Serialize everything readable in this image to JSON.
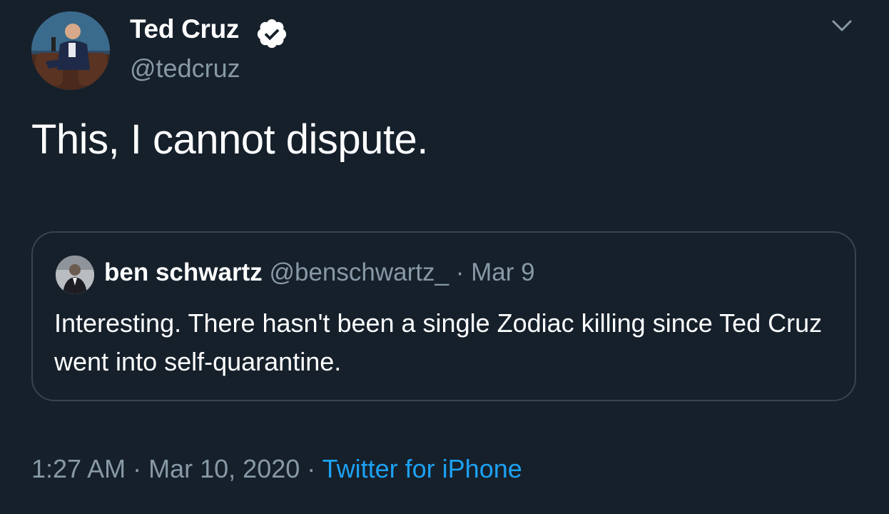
{
  "author": {
    "name": "Ted Cruz",
    "handle": "@tedcruz",
    "verified_icon": "verified-badge-icon"
  },
  "tweet": {
    "text": "This, I cannot dispute."
  },
  "quoted_tweet": {
    "name": "ben schwartz",
    "handle": "@benschwartz_",
    "separator": "·",
    "date": "Mar 9",
    "text": "Interesting. There hasn't been a single Zodiac killing since Ted Cruz went into self-quarantine."
  },
  "meta": {
    "time": "1:27 AM",
    "separator1": "·",
    "date": "Mar 10, 2020",
    "separator2": "·",
    "source": "Twitter for iPhone"
  },
  "colors": {
    "background": "#15202b",
    "text_primary": "#ffffff",
    "text_secondary": "#8899a6",
    "accent": "#1da1f2",
    "border": "#38444d"
  },
  "icons": {
    "more": "chevron-down-icon"
  }
}
